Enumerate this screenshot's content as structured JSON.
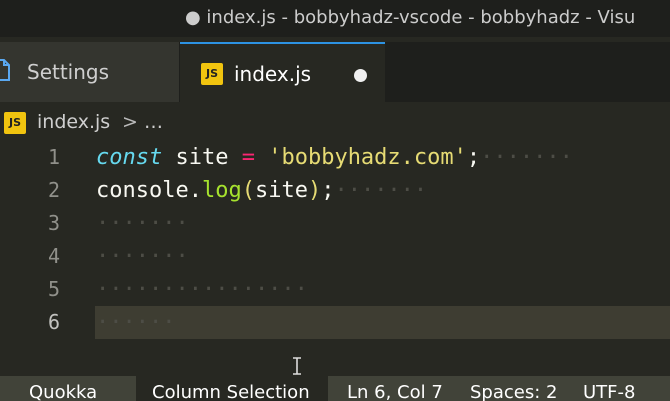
{
  "window": {
    "title": "● index.js - bobbyhadz-vscode - bobbyhadz - Visu"
  },
  "tabs": [
    {
      "label": "Settings",
      "icon": "settings-file-icon"
    },
    {
      "label": "index.js",
      "icon": "js-file-icon",
      "badge": "JS",
      "dirty": true
    }
  ],
  "breadcrumb": {
    "badge": "JS",
    "file": "index.js",
    "separator": ">",
    "more": "…"
  },
  "editor": {
    "lines": [
      {
        "number": "1",
        "parts": [
          {
            "text": "const",
            "cls": "kw"
          },
          {
            "text": " ",
            "cls": "pun"
          },
          {
            "text": "site",
            "cls": "pun"
          },
          {
            "text": " ",
            "cls": "pun"
          },
          {
            "text": "=",
            "cls": "op"
          },
          {
            "text": " ",
            "cls": "pun"
          },
          {
            "text": "'bobbyhadz.com'",
            "cls": "str"
          },
          {
            "text": ";",
            "cls": "pun"
          },
          {
            "text": "·······",
            "cls": "ws"
          }
        ]
      },
      {
        "number": "2",
        "parts": [
          {
            "text": "console",
            "cls": "pun"
          },
          {
            "text": ".",
            "cls": "pun"
          },
          {
            "text": "log",
            "cls": "fn"
          },
          {
            "text": "(",
            "cls": "str"
          },
          {
            "text": "site",
            "cls": "pun"
          },
          {
            "text": ")",
            "cls": "str"
          },
          {
            "text": ";",
            "cls": "pun"
          },
          {
            "text": "·······",
            "cls": "ws"
          }
        ]
      },
      {
        "number": "3",
        "parts": [
          {
            "text": "·······",
            "cls": "ws"
          }
        ]
      },
      {
        "number": "4",
        "parts": [
          {
            "text": "·······",
            "cls": "ws"
          }
        ]
      },
      {
        "number": "5",
        "parts": [
          {
            "text": "················",
            "cls": "ws"
          }
        ]
      },
      {
        "number": "6",
        "parts": [
          {
            "text": "······",
            "cls": "ws"
          }
        ],
        "current": true
      }
    ]
  },
  "statusbar": {
    "items": [
      "Quokka",
      "Column Selection",
      "Ln 6, Col 7",
      "Spaces: 2",
      "UTF-8"
    ]
  }
}
